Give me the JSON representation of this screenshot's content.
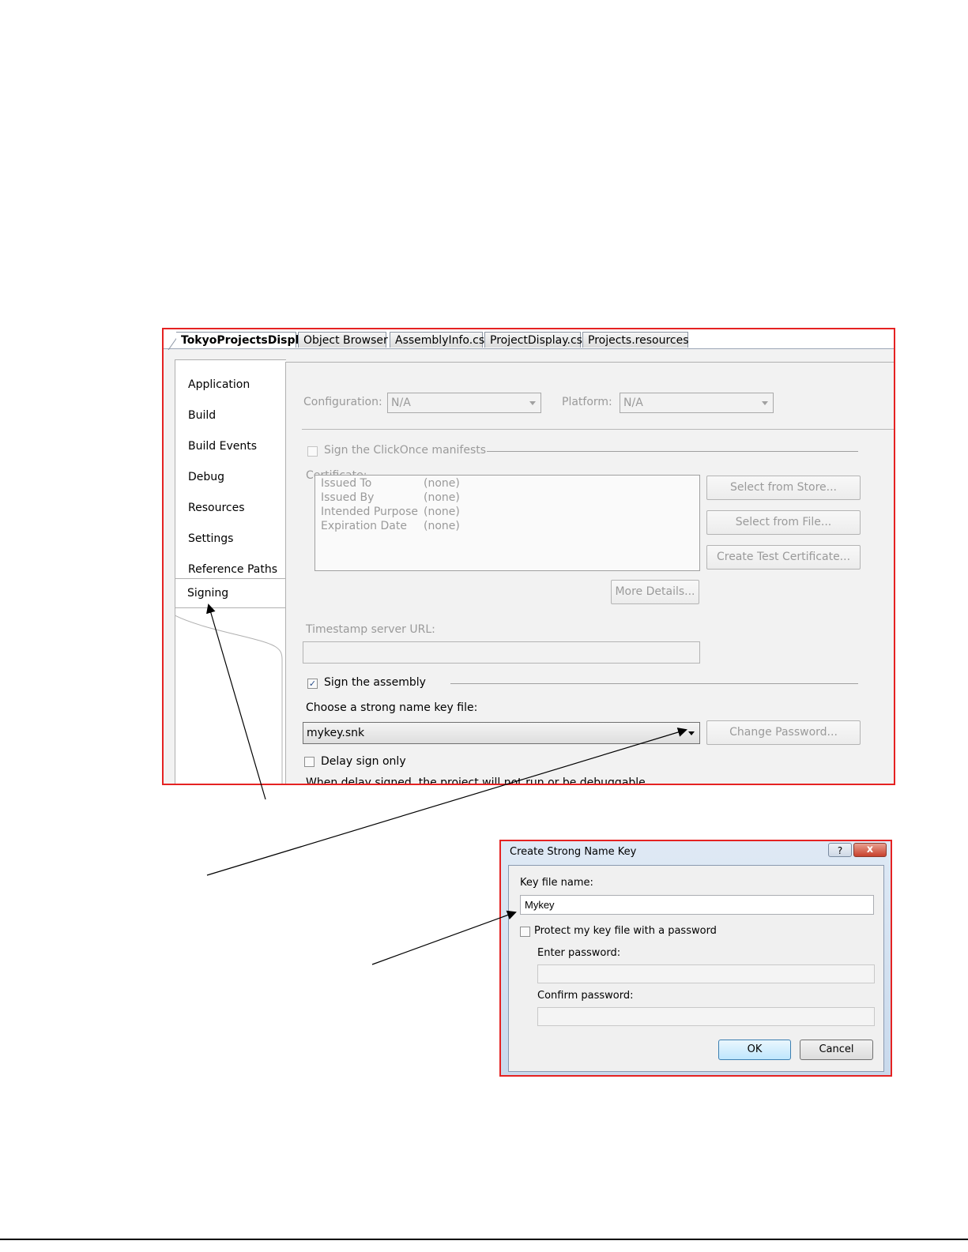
{
  "tabs": [
    "TokyoProjectsDisplay",
    "Object Browser",
    "AssemblyInfo.cs",
    "ProjectDisplay.cs",
    "Projects.resources"
  ],
  "sidebar": {
    "items": [
      "Application",
      "Build",
      "Build Events",
      "Debug",
      "Resources",
      "Settings",
      "Reference Paths",
      "Signing"
    ],
    "selected": "Signing"
  },
  "signing": {
    "configuration_label": "Configuration:",
    "configuration_value": "N/A",
    "platform_label": "Platform:",
    "platform_value": "N/A",
    "clickonce_label": "Sign the ClickOnce manifests",
    "clickonce_checked": false,
    "certificate_label": "Certificate:",
    "certificate": [
      {
        "key": "Issued To",
        "value": "(none)"
      },
      {
        "key": "Issued By",
        "value": "(none)"
      },
      {
        "key": "Intended Purpose",
        "value": "(none)"
      },
      {
        "key": "Expiration Date",
        "value": "(none)"
      }
    ],
    "select_store_button": "Select from Store...",
    "select_file_button": "Select from File...",
    "create_test_cert_button": "Create Test Certificate...",
    "more_details_button": "More Details...",
    "timestamp_label": "Timestamp server URL:",
    "timestamp_value": "",
    "sign_assembly_label": "Sign the assembly",
    "sign_assembly_checked": true,
    "key_file_label": "Choose a strong name key file:",
    "key_file_value": "mykey.snk",
    "change_password_button": "Change Password...",
    "delay_sign_label": "Delay sign only",
    "delay_sign_checked": false,
    "delay_note": "When delay signed, the project will not run or be debuggable."
  },
  "dialog": {
    "title": "Create Strong Name Key",
    "help_glyph": "?",
    "close_glyph": "x",
    "key_file_name_label": "Key file name:",
    "key_file_name_value": "Mykey",
    "protect_label": "Protect my key file with a password",
    "protect_checked": false,
    "enter_password_label": "Enter password:",
    "confirm_password_label": "Confirm password:",
    "ok_button": "OK",
    "cancel_button": "Cancel"
  },
  "colors": {
    "highlight_border": "#e52222",
    "panel_background": "#f2f2f2",
    "disabled_text": "#9a9a9a"
  }
}
